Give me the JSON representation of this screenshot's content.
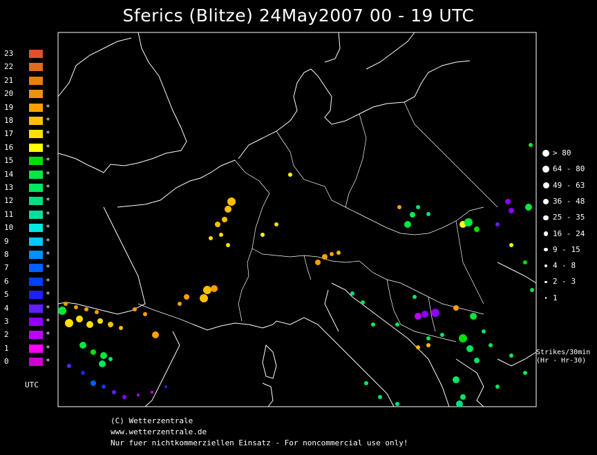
{
  "title": "Sferics (Blitze) 24May2007 00 - 19 UTC",
  "utc_legend": {
    "label": "UTC",
    "rows": [
      {
        "hour": "23",
        "color": "#e0502a",
        "star": ""
      },
      {
        "hour": "22",
        "color": "#e06a1e",
        "star": ""
      },
      {
        "hour": "21",
        "color": "#e8800e",
        "star": ""
      },
      {
        "hour": "20",
        "color": "#f09010",
        "star": ""
      },
      {
        "hour": "19",
        "color": "#ffa000",
        "star": "*"
      },
      {
        "hour": "18",
        "color": "#ffc000",
        "star": "*"
      },
      {
        "hour": "17",
        "color": "#ffe000",
        "star": "*"
      },
      {
        "hour": "16",
        "color": "#ffff00",
        "star": "*"
      },
      {
        "hour": "15",
        "color": "#00e000",
        "star": "*"
      },
      {
        "hour": "14",
        "color": "#00e840",
        "star": "*"
      },
      {
        "hour": "13",
        "color": "#00e860",
        "star": "*"
      },
      {
        "hour": "12",
        "color": "#00e080",
        "star": "*"
      },
      {
        "hour": "11",
        "color": "#00e0a0",
        "star": "*"
      },
      {
        "hour": "10",
        "color": "#00e8e0",
        "star": "*"
      },
      {
        "hour": "9",
        "color": "#00c8ff",
        "star": "*"
      },
      {
        "hour": "8",
        "color": "#0090ff",
        "star": "*"
      },
      {
        "hour": "7",
        "color": "#0060ff",
        "star": "*"
      },
      {
        "hour": "6",
        "color": "#0040ff",
        "star": "*"
      },
      {
        "hour": "5",
        "color": "#2020ff",
        "star": "*"
      },
      {
        "hour": "4",
        "color": "#6020ff",
        "star": "*"
      },
      {
        "hour": "3",
        "color": "#9000ff",
        "star": "*"
      },
      {
        "hour": "2",
        "color": "#c000ff",
        "star": "*"
      },
      {
        "hour": "1",
        "color": "#ff00ff",
        "star": "*"
      },
      {
        "hour": "0",
        "color": "#d000d0",
        "star": "*"
      }
    ]
  },
  "size_legend": {
    "rows": [
      {
        "label": "> 80",
        "level": 6
      },
      {
        "label": "64 - 80",
        "level": 5.5
      },
      {
        "label": "49 - 63",
        "level": 5
      },
      {
        "label": "36 - 48",
        "level": 4.5
      },
      {
        "label": "25 - 35",
        "level": 4
      },
      {
        "label": "16 - 24",
        "level": 3.5
      },
      {
        "label": "9 - 15",
        "level": 3
      },
      {
        "label": "4 - 8",
        "level": 2.5
      },
      {
        "label": "2 - 3",
        "level": 2
      },
      {
        "label": "1",
        "level": 1.5
      }
    ],
    "units": "Strikes/30min\n(Hr - Hr-30)"
  },
  "credits": {
    "line1": "(C) Wetterzentrale",
    "line2": "www.wetterzentrale.de",
    "line3": "Nur fuer nichtkommerziellen Einsatz - For noncommercial use only!"
  }
}
